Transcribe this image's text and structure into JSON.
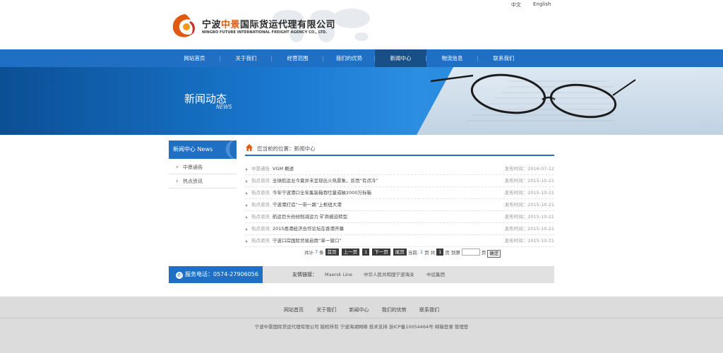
{
  "header": {
    "logo_cn_prefix": "宁波",
    "logo_cn_highlight": "中景",
    "logo_cn_suffix": "国际货运代理有限公司",
    "logo_en": "NINGBO FUTURE INTERNATIONAL FREIGHT AGENCY CO., LTD.",
    "lang_cn": "中文",
    "lang_en": "English"
  },
  "nav": {
    "items": [
      {
        "label": "网站首页"
      },
      {
        "label": "关于我们"
      },
      {
        "label": "经营范围"
      },
      {
        "label": "我们的优势"
      },
      {
        "label": "新闻中心"
      },
      {
        "label": "物流信息"
      },
      {
        "label": "联系我们"
      }
    ],
    "active_index": 4
  },
  "banner": {
    "title": "新闻动态",
    "subtitle": "NEWS"
  },
  "sidebar": {
    "heading": "新闻中心 News",
    "items": [
      {
        "label": "中景通告"
      },
      {
        "label": "热点资讯"
      }
    ]
  },
  "breadcrumb": {
    "text": "您当前的位置：新闻中心"
  },
  "news": [
    {
      "category": "中景通告",
      "title": "VGM 概述",
      "date": "发布时间：2016-07-12"
    },
    {
      "category": "热点资讯",
      "title": "全球航运业今夏并未呈现出火热景象，反而“有点冷”",
      "date": "发布时间：2015-10-21"
    },
    {
      "category": "热点资讯",
      "title": "今年宁波港口全年集装箱吞吐量或破2000万标箱",
      "date": "发布时间：2015-10-21"
    },
    {
      "category": "热点资讯",
      "title": "宁波港打造“一带一路”上枢纽大港",
      "date": "发布时间：2015-10-21"
    },
    {
      "category": "热点资讯",
      "title": "航运巨头纷纷削减运力 矿商被迫转型",
      "date": "发布时间：2015-10-21"
    },
    {
      "category": "热点资讯",
      "title": "2015甬港经济合作论坛在香港开幕",
      "date": "发布时间：2015-10-21"
    },
    {
      "category": "热点资讯",
      "title": "宁波口岸国际贸易启用“单一窗口”",
      "date": "发布时间：2015-10-21"
    }
  ],
  "pager": {
    "total_prefix": "共计",
    "total_count": "7",
    "total_suffix": "条",
    "first": "首页",
    "prev": "上一页",
    "current": "1",
    "next": "下一页",
    "last": "尾页",
    "page_info_prefix": "当前:",
    "page_info_cur": "1",
    "page_info_mid": "页 共",
    "page_info_total": "1",
    "page_info_suffix": "页 到第",
    "go_suffix": "页",
    "go_button": "确定"
  },
  "service": {
    "label": "服务电话：0574-27906056"
  },
  "friend_links": {
    "label": "友情链接：",
    "items": [
      {
        "label": "Maersk Line"
      },
      {
        "label": "中华人民共和国宁波海关"
      },
      {
        "label": "中远集团"
      }
    ]
  },
  "footer": {
    "nav": [
      {
        "label": "网站首页"
      },
      {
        "label": "关于我们"
      },
      {
        "label": "新闻中心"
      },
      {
        "label": "我们的优势"
      },
      {
        "label": "联系我们"
      }
    ],
    "copyright": "宁波中景国际货运代理有限公司 版权所有 宁波海湖网络 技术支持 浙ICP备10054464号 邮箱登录 管理登"
  },
  "colors": {
    "brand_blue": "#1f6fc4",
    "nav_active": "#174f86",
    "logo_highlight": "#e05a12"
  }
}
